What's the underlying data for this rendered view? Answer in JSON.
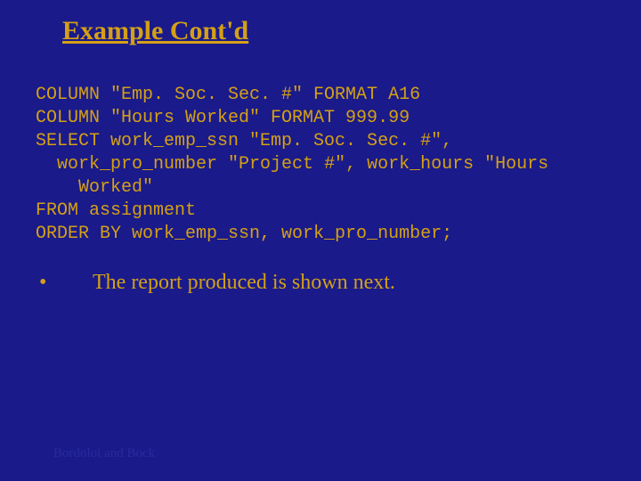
{
  "title": "Example Cont'd",
  "code": "COLUMN \"Emp. Soc. Sec. #\" FORMAT A16\nCOLUMN \"Hours Worked\" FORMAT 999.99\nSELECT work_emp_ssn \"Emp. Soc. Sec. #\",\n  work_pro_number \"Project #\", work_hours \"Hours\n    Worked\"\nFROM assignment\nORDER BY work_emp_ssn, work_pro_number;",
  "bullet": {
    "marker": "•",
    "text": "The report produced is shown next."
  },
  "footer": "Bordoloi and Bock"
}
